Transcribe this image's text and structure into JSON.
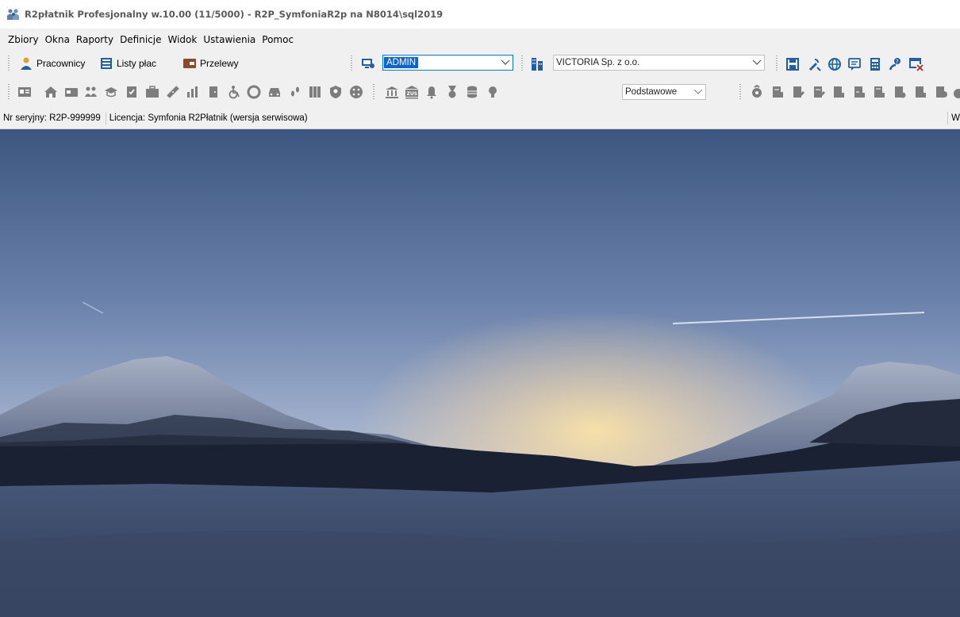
{
  "window": {
    "title": "R2płatnik Profesjonalny w.10.00 (11/5000) - R2P_SymfoniaR2p na N8014\\sql2019",
    "icon": "people-group-icon"
  },
  "menu": [
    "Zbiory",
    "Okna",
    "Raporty",
    "Definicje",
    "Widok",
    "Ustawienia",
    "Pomoc"
  ],
  "toolbar": {
    "employees_label": "Pracownicy",
    "payrolls_label": "Listy płac",
    "transfers_label": "Przelewy",
    "user_select": "ADMIN",
    "company_select": "VICTORIA Sp. z o.o.",
    "view_select": "Podstawowe"
  },
  "status": {
    "serial": "Nr seryjny: R2P-999999",
    "license": "Licencja: Symfonia R2Płatnik (wersja serwisowa)",
    "right_fragment": "W"
  },
  "colors": {
    "accent_blue": "#0a64d8",
    "icon_blue": "#1f5fa8",
    "icon_gray": "#7d7d7d",
    "transfers_icon": "#8a4a2e"
  }
}
